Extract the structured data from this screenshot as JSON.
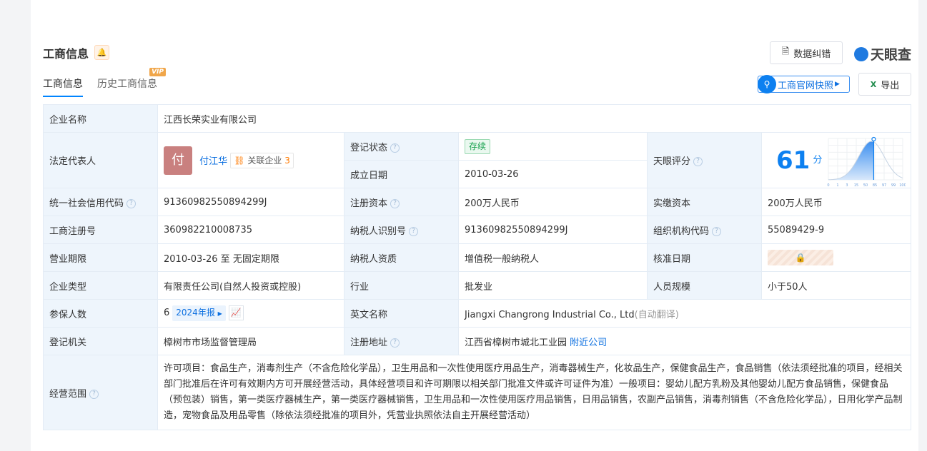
{
  "header": {
    "title": "工商信息",
    "bell_icon": "bell-icon",
    "correction": "数据纠错",
    "brand": "天眼查",
    "snapshot": "工商官网快照",
    "export": "导出"
  },
  "tabs": [
    {
      "label": "工商信息",
      "active": true
    },
    {
      "label": "历史工商信息",
      "badge": "VIP"
    }
  ],
  "info": {
    "company_name_label": "企业名称",
    "company_name": "江西长荣实业有限公司",
    "legal_rep_label": "法定代表人",
    "legal_rep_avatar": "付",
    "legal_rep": "付江华",
    "related_label": "关联企业",
    "related_count": "3",
    "status_label": "登记状态",
    "status": "存续",
    "founded_label": "成立日期",
    "founded": "2010-03-26",
    "score_label": "天眼评分",
    "score": "61",
    "score_unit": "分",
    "credit_code_label": "统一社会信用代码",
    "credit_code": "91360982550894299J",
    "reg_capital_label": "注册资本",
    "reg_capital": "200万人民币",
    "paid_capital_label": "实缴资本",
    "paid_capital": "200万人民币",
    "reg_no_label": "工商注册号",
    "reg_no": "360982210008735",
    "taxpayer_id_label": "纳税人识别号",
    "taxpayer_id": "91360982550894299J",
    "org_code_label": "组织机构代码",
    "org_code": "55089429-9",
    "term_label": "营业期限",
    "term": "2010-03-26 至 无固定期限",
    "tax_qual_label": "纳税人资质",
    "tax_qual": "增值税一般纳税人",
    "approval_label": "核准日期",
    "type_label": "企业类型",
    "type": "有限责任公司(自然人投资或控股)",
    "industry_label": "行业",
    "industry": "批发业",
    "staff_label": "人员规模",
    "staff": "小于50人",
    "insured_label": "参保人数",
    "insured": "6",
    "report_year": "2024年报",
    "en_name_label": "英文名称",
    "en_name": "Jiangxi Changrong Industrial Co., Ltd",
    "auto_translate": "(自动翻译)",
    "authority_label": "登记机关",
    "authority": "樟树市市场监督管理局",
    "address_label": "注册地址",
    "address": "江西省樟树市城北工业园",
    "nearby": "附近公司",
    "scope_label": "经营范围",
    "scope": "许可项目：食品生产，消毒剂生产（不含危险化学品），卫生用品和一次性使用医疗用品生产，消毒器械生产，化妆品生产，保健食品生产，食品销售（依法须经批准的项目，经相关部门批准后在许可有效期内方可开展经营活动，具体经营项目和许可期限以相关部门批准文件或许可证件为准）一般项目：婴幼儿配方乳粉及其他婴幼儿配方食品销售，保健食品（预包装）销售，第一类医疗器械生产，第一类医疗器械销售，卫生用品和一次性使用医疗用品销售，日用品销售，农副产品销售，消毒剂销售（不含危险化学品），日用化学产品制造，宠物食品及用品零售（除依法须经批准的项目外，凭营业执照依法自主开展经营活动）"
  },
  "score_chart": {
    "ticks": [
      "0",
      "1",
      "3",
      "15",
      "50",
      "85",
      "97",
      "99",
      "100"
    ],
    "marker_percentile": 61
  }
}
